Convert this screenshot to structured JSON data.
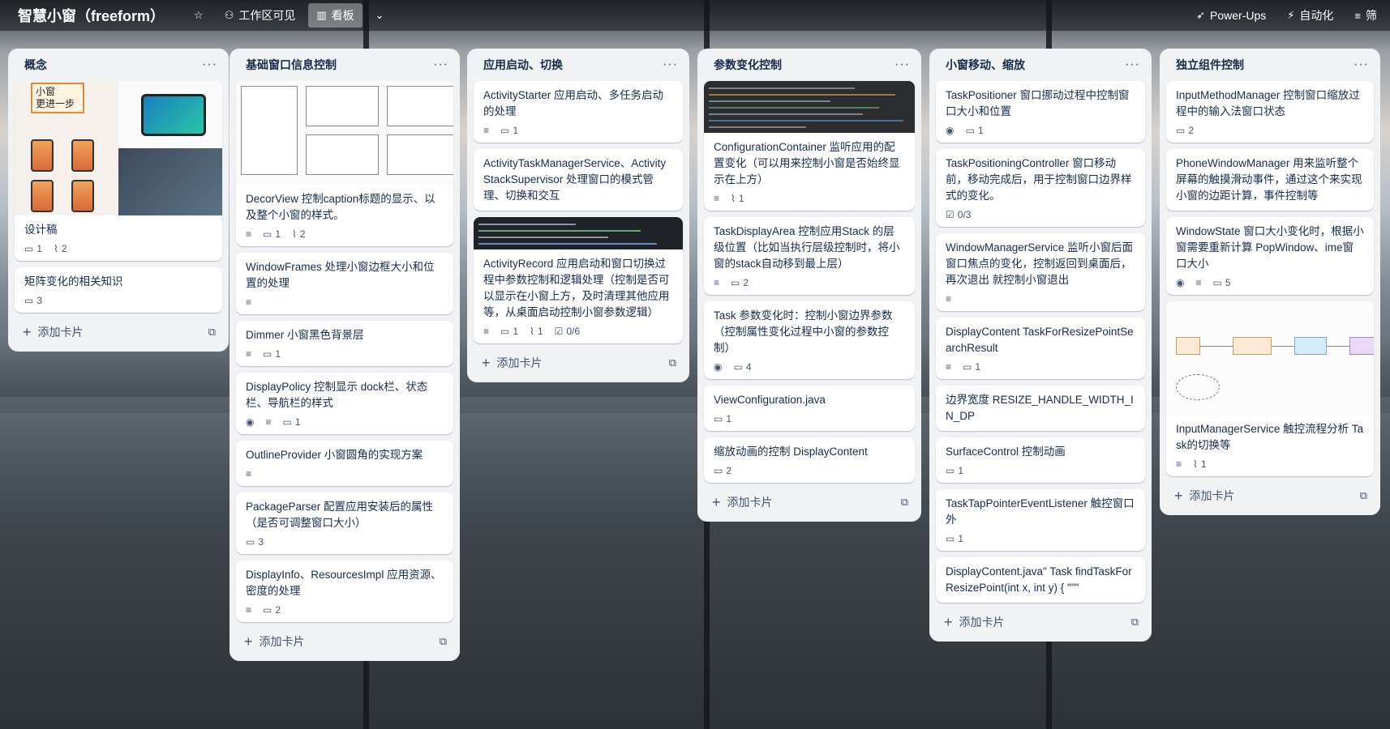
{
  "header": {
    "board_title": "智慧小窗（freeform）",
    "workspace_visible": "工作区可见",
    "view_board": "看板",
    "power_ups": "Power-Ups",
    "automation": "自动化",
    "filter": "筛"
  },
  "add_card_label": "添加卡片",
  "lists": [
    {
      "title": "概念",
      "cards": [
        {
          "title": "设计稿",
          "comments": "1",
          "attachments": "2",
          "cover_tag": "小窗\n更进一步"
        },
        {
          "title": "矩阵变化的相关知识",
          "comments": "3"
        }
      ]
    },
    {
      "title": "基础窗口信息控制",
      "cards": [
        {
          "title": "DecorView 控制caption标题的显示、以及整个小窗的样式。",
          "comments": "1",
          "attachments": "2"
        },
        {
          "title": "WindowFrames 处理小窗边框大小和位置的处理"
        },
        {
          "title": "Dimmer 小窗黑色背景层",
          "comments": "1"
        },
        {
          "title": "DisplayPolicy 控制显示 dock栏、状态栏、导航栏的样式",
          "comments": "1"
        },
        {
          "title": "OutlineProvider 小窗圆角的实现方案"
        },
        {
          "title": "PackageParser 配置应用安装后的属性（是否可调整窗口大小）",
          "comments": "3"
        },
        {
          "title": "DisplayInfo、ResourcesImpl 应用资源、密度的处理",
          "comments": "2"
        }
      ]
    },
    {
      "title": "应用启动、切换",
      "cards": [
        {
          "title": "ActivityStarter 应用启动、多任务启动的处理",
          "comments": "1"
        },
        {
          "title": "ActivityTaskManagerService、ActivityStackSupervisor 处理窗口的模式管理、切换和交互"
        },
        {
          "title": "ActivityRecord 应用启动和窗口切换过程中参数控制和逻辑处理（控制是否可以显示在小窗上方，及时清理其他应用等，从桌面启动控制小窗参数逻辑）",
          "comments": "1",
          "attachments": "1",
          "checklist": "0/6"
        }
      ]
    },
    {
      "title": "参数变化控制",
      "cards": [
        {
          "title": "ConfigurationContainer 监听应用的配置变化（可以用来控制小窗是否始终显示在上方）",
          "attachments": "1"
        },
        {
          "title": "TaskDisplayArea 控制应用Stack 的层级位置（比如当执行层级控制时，将小窗的stack自动移到最上层）",
          "comments": "2"
        },
        {
          "title": "Task 参数变化时：控制小窗边界参数（控制属性变化过程中小窗的参数控制）",
          "comments": "4"
        },
        {
          "title": "ViewConfiguration.java",
          "comments": "1"
        },
        {
          "title": "缩放动画的控制 DisplayContent",
          "comments": "2"
        }
      ]
    },
    {
      "title": "小窗移动、缩放",
      "cards": [
        {
          "title": "TaskPositioner 窗口挪动过程中控制窗口大小和位置",
          "comments": "1"
        },
        {
          "title": "TaskPositioningController 窗口移动前，移动完成后，用于控制窗口边界样式的变化。",
          "checklist": "0/3"
        },
        {
          "title": "WindowManagerService 监听小窗后面窗口焦点的变化，控制返回到桌面后，再次退出 就控制小窗退出"
        },
        {
          "title": "DisplayContent TaskForResizePointSearchResult",
          "comments": "1"
        },
        {
          "title": "边界宽度 RESIZE_HANDLE_WIDTH_IN_DP"
        },
        {
          "title": "SurfaceControl 控制动画",
          "comments": "1"
        },
        {
          "title": "TaskTapPointerEventListener 触控窗口外",
          "comments": "1"
        },
        {
          "title": "DisplayContent.java\" Task findTaskForResizePoint(int x, int y) { \"\"\""
        }
      ]
    },
    {
      "title": "独立组件控制",
      "cards": [
        {
          "title": "InputMethodManager 控制窗口缩放过程中的输入法窗口状态",
          "comments": "2"
        },
        {
          "title": "PhoneWindowManager 用来监听整个屏幕的触摸滑动事件，通过这个来实现小窗的边距计算，事件控制等"
        },
        {
          "title": "WindowState 窗口大小变化时，根据小窗需要重新计算 PopWindow、ime窗口大小",
          "comments": "5"
        },
        {
          "title": "InputManagerService 触控流程分析 Task的切换等",
          "attachments": "1"
        }
      ]
    }
  ],
  "colors": {
    "list_bg": "#f1f2f4",
    "card_bg": "#ffffff",
    "text": "#172b4d",
    "meta": "#44546f"
  }
}
